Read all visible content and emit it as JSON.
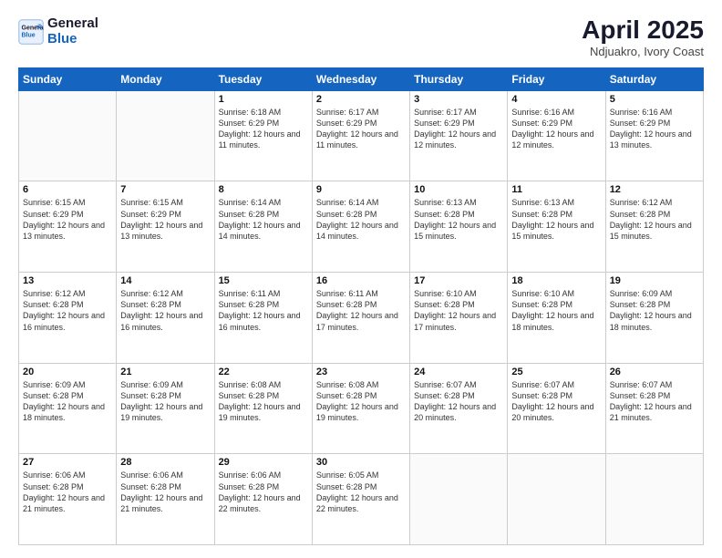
{
  "header": {
    "logo_line1": "General",
    "logo_line2": "Blue",
    "title": "April 2025",
    "subtitle": "Ndjuakro, Ivory Coast"
  },
  "days_of_week": [
    "Sunday",
    "Monday",
    "Tuesday",
    "Wednesday",
    "Thursday",
    "Friday",
    "Saturday"
  ],
  "weeks": [
    [
      {
        "day": "",
        "info": ""
      },
      {
        "day": "",
        "info": ""
      },
      {
        "day": "1",
        "info": "Sunrise: 6:18 AM\nSunset: 6:29 PM\nDaylight: 12 hours and 11 minutes."
      },
      {
        "day": "2",
        "info": "Sunrise: 6:17 AM\nSunset: 6:29 PM\nDaylight: 12 hours and 11 minutes."
      },
      {
        "day": "3",
        "info": "Sunrise: 6:17 AM\nSunset: 6:29 PM\nDaylight: 12 hours and 12 minutes."
      },
      {
        "day": "4",
        "info": "Sunrise: 6:16 AM\nSunset: 6:29 PM\nDaylight: 12 hours and 12 minutes."
      },
      {
        "day": "5",
        "info": "Sunrise: 6:16 AM\nSunset: 6:29 PM\nDaylight: 12 hours and 13 minutes."
      }
    ],
    [
      {
        "day": "6",
        "info": "Sunrise: 6:15 AM\nSunset: 6:29 PM\nDaylight: 12 hours and 13 minutes."
      },
      {
        "day": "7",
        "info": "Sunrise: 6:15 AM\nSunset: 6:29 PM\nDaylight: 12 hours and 13 minutes."
      },
      {
        "day": "8",
        "info": "Sunrise: 6:14 AM\nSunset: 6:28 PM\nDaylight: 12 hours and 14 minutes."
      },
      {
        "day": "9",
        "info": "Sunrise: 6:14 AM\nSunset: 6:28 PM\nDaylight: 12 hours and 14 minutes."
      },
      {
        "day": "10",
        "info": "Sunrise: 6:13 AM\nSunset: 6:28 PM\nDaylight: 12 hours and 15 minutes."
      },
      {
        "day": "11",
        "info": "Sunrise: 6:13 AM\nSunset: 6:28 PM\nDaylight: 12 hours and 15 minutes."
      },
      {
        "day": "12",
        "info": "Sunrise: 6:12 AM\nSunset: 6:28 PM\nDaylight: 12 hours and 15 minutes."
      }
    ],
    [
      {
        "day": "13",
        "info": "Sunrise: 6:12 AM\nSunset: 6:28 PM\nDaylight: 12 hours and 16 minutes."
      },
      {
        "day": "14",
        "info": "Sunrise: 6:12 AM\nSunset: 6:28 PM\nDaylight: 12 hours and 16 minutes."
      },
      {
        "day": "15",
        "info": "Sunrise: 6:11 AM\nSunset: 6:28 PM\nDaylight: 12 hours and 16 minutes."
      },
      {
        "day": "16",
        "info": "Sunrise: 6:11 AM\nSunset: 6:28 PM\nDaylight: 12 hours and 17 minutes."
      },
      {
        "day": "17",
        "info": "Sunrise: 6:10 AM\nSunset: 6:28 PM\nDaylight: 12 hours and 17 minutes."
      },
      {
        "day": "18",
        "info": "Sunrise: 6:10 AM\nSunset: 6:28 PM\nDaylight: 12 hours and 18 minutes."
      },
      {
        "day": "19",
        "info": "Sunrise: 6:09 AM\nSunset: 6:28 PM\nDaylight: 12 hours and 18 minutes."
      }
    ],
    [
      {
        "day": "20",
        "info": "Sunrise: 6:09 AM\nSunset: 6:28 PM\nDaylight: 12 hours and 18 minutes."
      },
      {
        "day": "21",
        "info": "Sunrise: 6:09 AM\nSunset: 6:28 PM\nDaylight: 12 hours and 19 minutes."
      },
      {
        "day": "22",
        "info": "Sunrise: 6:08 AM\nSunset: 6:28 PM\nDaylight: 12 hours and 19 minutes."
      },
      {
        "day": "23",
        "info": "Sunrise: 6:08 AM\nSunset: 6:28 PM\nDaylight: 12 hours and 19 minutes."
      },
      {
        "day": "24",
        "info": "Sunrise: 6:07 AM\nSunset: 6:28 PM\nDaylight: 12 hours and 20 minutes."
      },
      {
        "day": "25",
        "info": "Sunrise: 6:07 AM\nSunset: 6:28 PM\nDaylight: 12 hours and 20 minutes."
      },
      {
        "day": "26",
        "info": "Sunrise: 6:07 AM\nSunset: 6:28 PM\nDaylight: 12 hours and 21 minutes."
      }
    ],
    [
      {
        "day": "27",
        "info": "Sunrise: 6:06 AM\nSunset: 6:28 PM\nDaylight: 12 hours and 21 minutes."
      },
      {
        "day": "28",
        "info": "Sunrise: 6:06 AM\nSunset: 6:28 PM\nDaylight: 12 hours and 21 minutes."
      },
      {
        "day": "29",
        "info": "Sunrise: 6:06 AM\nSunset: 6:28 PM\nDaylight: 12 hours and 22 minutes."
      },
      {
        "day": "30",
        "info": "Sunrise: 6:05 AM\nSunset: 6:28 PM\nDaylight: 12 hours and 22 minutes."
      },
      {
        "day": "",
        "info": ""
      },
      {
        "day": "",
        "info": ""
      },
      {
        "day": "",
        "info": ""
      }
    ]
  ]
}
